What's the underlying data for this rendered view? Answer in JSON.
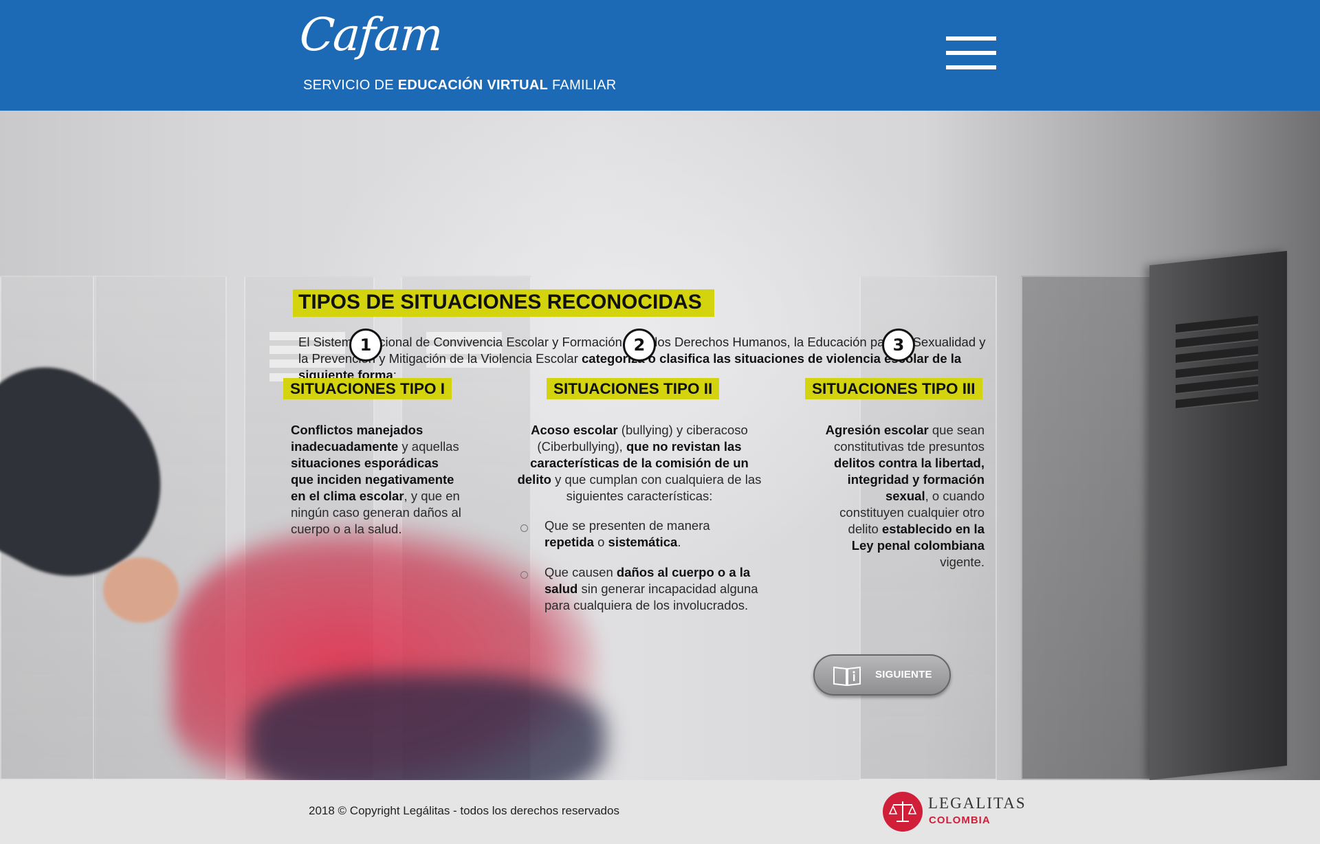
{
  "header": {
    "logo": "Cafam",
    "tagline_part1": "SERVICIO DE ",
    "tagline_bold": "EDUCACIÓN VIRTUAL",
    "tagline_part2": " FAMILIAR",
    "menu_icon": "hamburger-menu-icon"
  },
  "main": {
    "title": "TIPOS DE SITUACIONES RECONOCIDAS",
    "intro_text": "El Sistema Nacional de Convivencia Escolar y Formación para los Derechos Humanos, la Educación para la Sexualidad y la Prevención y Mitigación de la Violencia Escolar ",
    "intro_bold": "categoriza o clasifica las situaciones de violencia escolar de la siguiente forma",
    "intro_end": ":",
    "columns": [
      {
        "number": "1",
        "title": "SITUACIONES TIPO I",
        "b1": "Conflictos manejados inadecuadamente",
        "t1": " y aquellas ",
        "b2": "situaciones esporádicas que inciden negativamente en el clima escolar",
        "t2": ", y que en ningún caso generan daños al cuerpo o a la salud."
      },
      {
        "number": "2",
        "title": "SITUACIONES TIPO II",
        "b1": "Acoso escolar",
        "t1": " (bullying) y ciberacoso (Ciberbullying), ",
        "b2": "que no revistan las características de la comisión de un delito",
        "t2": " y que cumplan con cualquiera de las siguientes características:",
        "bullets": [
          {
            "t1": "Que se presenten de manera ",
            "b1": "repetida",
            "t2": " o ",
            "b2": "sistemática",
            "t3": "."
          },
          {
            "t1": "Que causen ",
            "b1": "daños al cuerpo o a la salud",
            "t2": " sin generar incapacidad alguna para cualquiera de los involucrados."
          }
        ]
      },
      {
        "number": "3",
        "title": "SITUACIONES TIPO III",
        "b1": "Agresión escolar",
        "t1": " que sean constitutivas tde presuntos ",
        "b2": "delitos contra la libertad, integridad y formación sexual",
        "t2": ", o cuando constituyen cualquier otro delito ",
        "b3": "establecido en la Ley penal colombiana",
        "t3": " vigente."
      }
    ],
    "next_button": {
      "label": "SIGUIENTE",
      "icon": "book-info-icon"
    }
  },
  "footer": {
    "copyright": "2018 © Copyright Legálitas - todos los derechos reservados",
    "brand_name": "LEGALITAS",
    "brand_sub": "COLOMBIA",
    "brand_icon": "scales-of-justice-icon"
  },
  "colors": {
    "header_bg": "#1c69b5",
    "highlight": "#d4d40e",
    "brand_red": "#d11f3a"
  }
}
